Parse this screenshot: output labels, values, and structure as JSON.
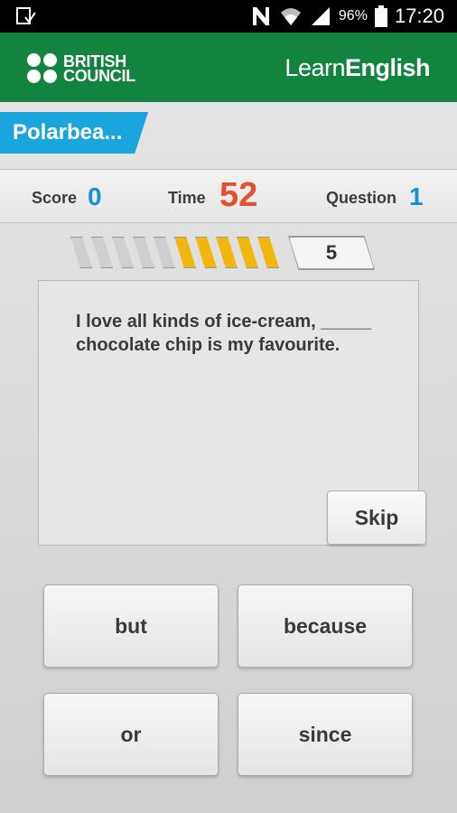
{
  "status_bar": {
    "battery": "96%",
    "time": "17:20",
    "icons": [
      "download-done-icon",
      "nfc-icon",
      "wifi-icon",
      "signal-icon",
      "battery-icon"
    ]
  },
  "header": {
    "brand_line1": "BRITISH",
    "brand_line2": "COUNCIL",
    "app_name_part1": "Learn",
    "app_name_part2": "English",
    "color": "#13843f"
  },
  "player": {
    "name": "Polarbea..."
  },
  "scoreboard": {
    "score_label": "Score",
    "score_value": "0",
    "time_label": "Time",
    "time_value": "52",
    "question_label": "Question",
    "question_value": "1"
  },
  "progress": {
    "completed_segments": 5,
    "remaining_segments": 5,
    "questions_remaining": "5",
    "colors": {
      "grey": "#cfcfcf",
      "yellow": "#f2b70c"
    }
  },
  "question": {
    "text": "I love all kinds of ice-cream, _____ chocolate chip is my favourite.",
    "skip_label": "Skip"
  },
  "answers": [
    {
      "label": "but"
    },
    {
      "label": "because"
    },
    {
      "label": "or"
    },
    {
      "label": "since"
    }
  ]
}
